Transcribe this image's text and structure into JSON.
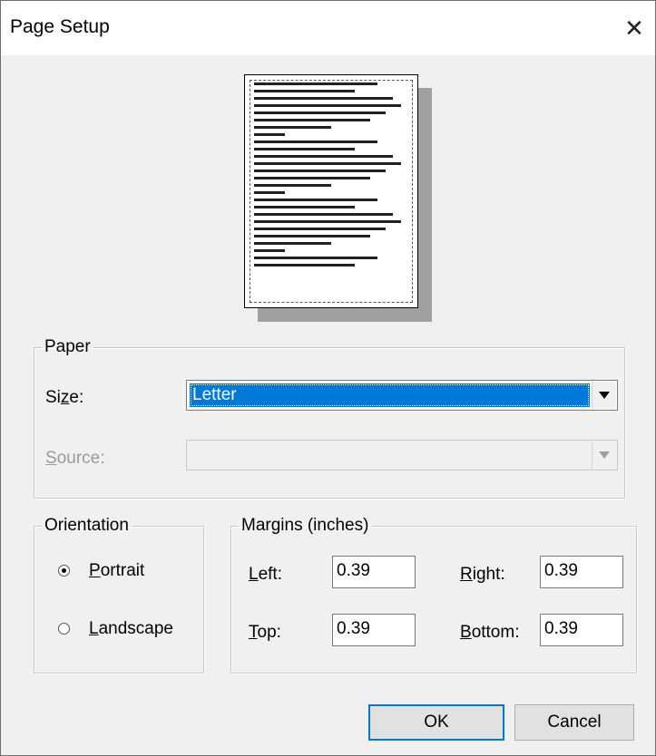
{
  "window": {
    "title": "Page Setup",
    "close_icon": "close-icon"
  },
  "preview": {
    "line_count": 26
  },
  "paper": {
    "legend": "Paper",
    "size_label_pre": "Si",
    "size_label_ul": "z",
    "size_label_post": "e:",
    "size_value": "Letter",
    "source_label_ul": "S",
    "source_label_post": "ource:",
    "source_value": ""
  },
  "orientation": {
    "legend": "Orientation",
    "portrait_ul": "P",
    "portrait_post": "ortrait",
    "landscape_ul": "L",
    "landscape_post": "andscape",
    "selected": "portrait"
  },
  "margins": {
    "legend": "Margins (inches)",
    "left_ul": "L",
    "left_post": "eft:",
    "left_value": "0.39",
    "right_ul": "R",
    "right_post": "ight:",
    "right_value": "0.39",
    "top_ul": "T",
    "top_post": "op:",
    "top_value": "0.39",
    "bottom_ul": "B",
    "bottom_post": "ottom:",
    "bottom_value": "0.39"
  },
  "buttons": {
    "ok": "OK",
    "cancel": "Cancel"
  },
  "colors": {
    "selection": "#0078d7",
    "dialog_bg": "#f0f0f0"
  }
}
